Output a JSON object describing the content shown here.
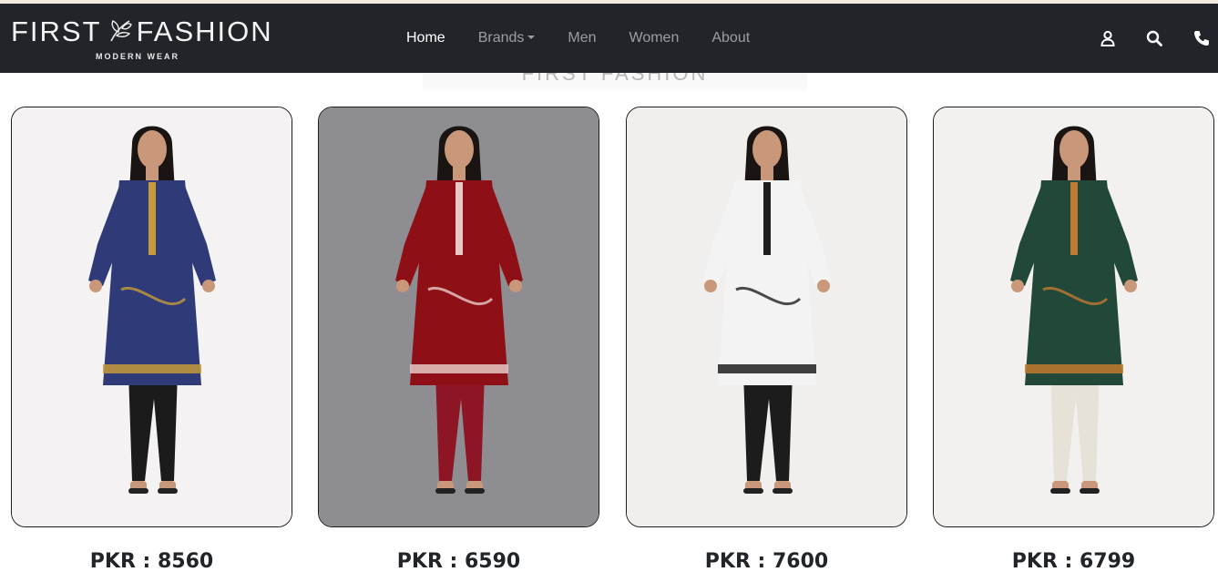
{
  "brand": {
    "name_left": "FIRST",
    "name_right": "FASHION",
    "tagline": "MODERN WEAR"
  },
  "nav": {
    "items": [
      {
        "label": "Home",
        "active": true
      },
      {
        "label": "Brands",
        "dropdown": true
      },
      {
        "label": "Men"
      },
      {
        "label": "Women"
      },
      {
        "label": "About"
      }
    ],
    "icons": [
      "user-icon",
      "search-icon",
      "phone-icon"
    ]
  },
  "banner_ghost_text": "FIRST FASHION",
  "products": [
    {
      "price": "PKR : 8560",
      "background": "#f4f2f2",
      "kurta_color": "#2f3b79",
      "accent": "#c79a3a",
      "pants_color": "#1b1b1b"
    },
    {
      "price": "PKR : 6590",
      "background": "#8e8e92",
      "kurta_color": "#8e1016",
      "accent": "#e8c9c4",
      "pants_color": "#8d1524"
    },
    {
      "price": "PKR : 7600",
      "background": "#f1efed",
      "kurta_color": "#f3f3f3",
      "accent": "#1e1e1e",
      "pants_color": "#1c1c1c"
    },
    {
      "price": "PKR : 6799",
      "background": "#f3f1ef",
      "kurta_color": "#22483a",
      "accent": "#c27a2e",
      "pants_color": "#e7e2d8"
    }
  ],
  "colors": {
    "navbar_bg": "#212529",
    "card_border": "#1d1d1d",
    "price_text": "#212529"
  }
}
